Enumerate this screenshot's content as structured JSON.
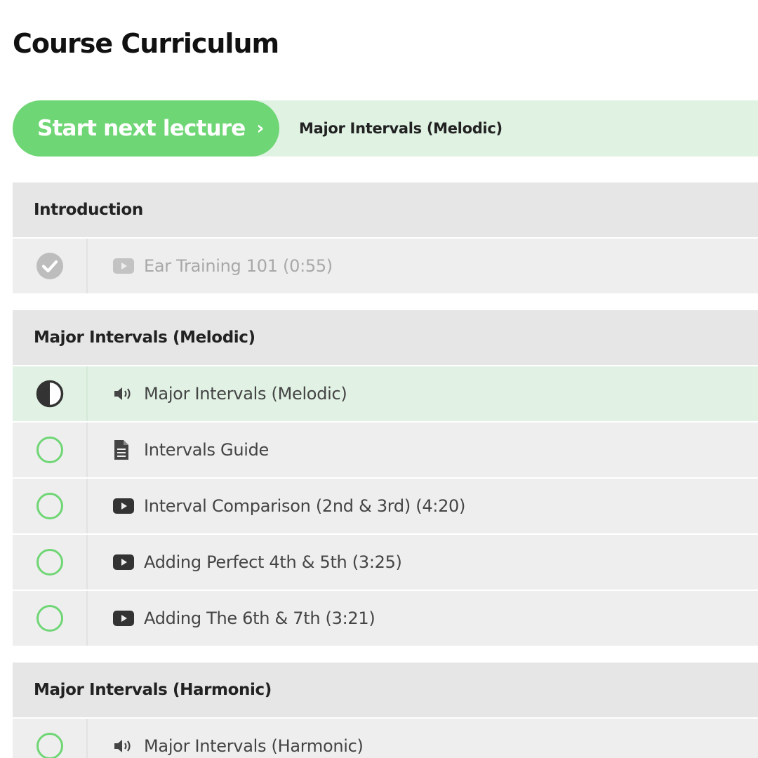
{
  "page": {
    "title": "Course Curriculum"
  },
  "next_lecture": {
    "button_label": "Start next lecture",
    "chevron": "›",
    "lecture_title": "Major Intervals (Melodic)"
  },
  "colors": {
    "accent": "#6fd675",
    "accent_bg": "#e0f3e3",
    "header_bg": "#e6e6e6",
    "row_bg": "#eeeeee"
  },
  "sections": [
    {
      "title": "Introduction",
      "lectures": [
        {
          "label": "Ear Training 101 (0:55)",
          "type": "video-icon",
          "status": "completed"
        }
      ]
    },
    {
      "title": "Major Intervals (Melodic)",
      "lectures": [
        {
          "label": "Major Intervals (Melodic)",
          "type": "audio-icon",
          "status": "in-progress"
        },
        {
          "label": "Intervals Guide",
          "type": "document-icon",
          "status": "not-started"
        },
        {
          "label": "Interval Comparison (2nd & 3rd) (4:20)",
          "type": "video-icon",
          "status": "not-started"
        },
        {
          "label": "Adding Perfect 4th & 5th (3:25)",
          "type": "video-icon",
          "status": "not-started"
        },
        {
          "label": "Adding The 6th & 7th (3:21)",
          "type": "video-icon",
          "status": "not-started"
        }
      ]
    },
    {
      "title": "Major Intervals (Harmonic)",
      "lectures": [
        {
          "label": "Major Intervals (Harmonic)",
          "type": "audio-icon",
          "status": "not-started"
        }
      ]
    }
  ]
}
